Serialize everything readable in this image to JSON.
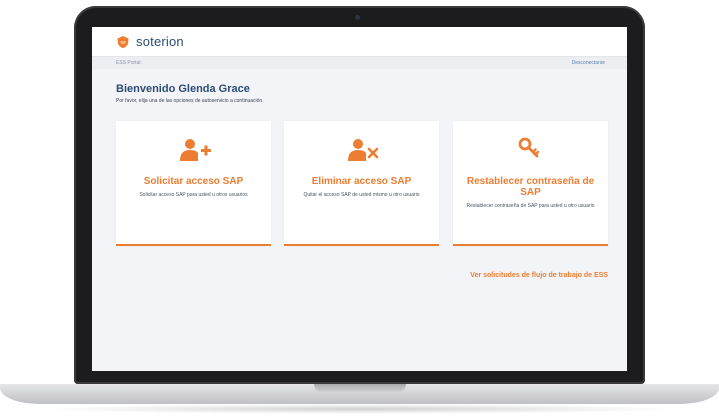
{
  "header": {
    "brand": "soterion"
  },
  "subbar": {
    "portal": "ESS Portal",
    "logout": "Desconectarse"
  },
  "welcome": {
    "title": "Bienvenido Glenda Grace",
    "intro": "Por favor, elija una de las opciones de autoservicio a continuación."
  },
  "cards": [
    {
      "title": "Solicitar acceso SAP",
      "description": "Solicitar acceso SAP para usted u otros usuarios",
      "icon": "user-add-icon"
    },
    {
      "title": "Eliminar acceso SAP",
      "description": "Quitar el acceso SAP de usted mismo u otro usuario",
      "icon": "user-remove-icon"
    },
    {
      "title": "Restablecer contraseña de SAP",
      "description": "Restablecer contraseña de SAP para usted u otro usuario",
      "icon": "key-icon"
    }
  ],
  "workflow_link": "Ver solicitudes de flujo de trabajo de ESS",
  "colors": {
    "accent": "#ed7d31",
    "brand": "#2b4d74",
    "link": "#5b82b6"
  }
}
